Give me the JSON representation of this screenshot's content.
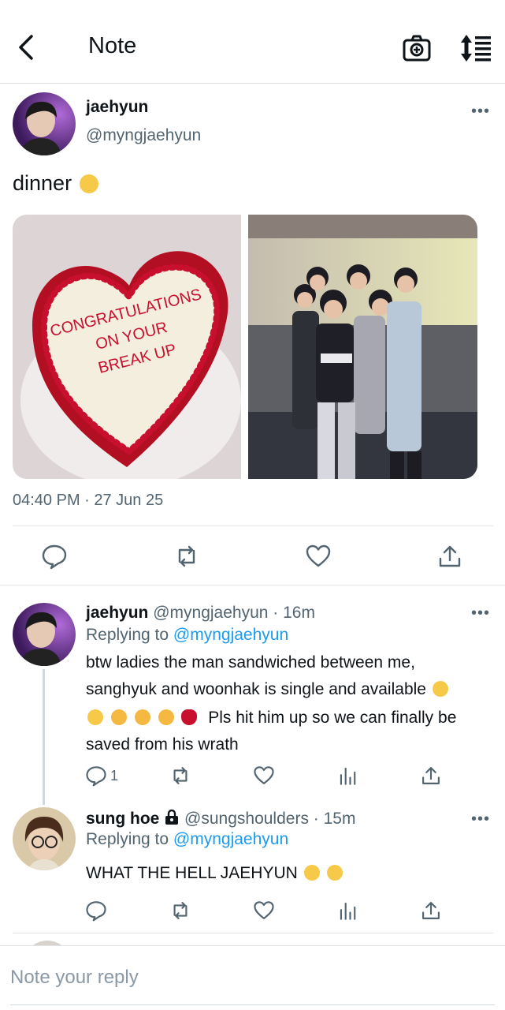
{
  "header": {
    "title": "Note"
  },
  "main_post": {
    "name": "jaehyun",
    "handle": "@myngjaehyun",
    "text": "dinner",
    "cake_text": [
      "CONGRATULATIONS",
      "ON YOUR",
      "BREAK UP"
    ],
    "timestamp": "04:40 PM · 27 Jun 25"
  },
  "replies": [
    {
      "name": "jaehyun",
      "handle": "@myngjaehyun",
      "time": "· 16m",
      "replying_prefix": "Replying to",
      "replying_to": "@myngjaehyun",
      "line1": "btw ladies the man sandwiched between me,",
      "line2": "sanghyuk and woonhak is single and available",
      "line3": "Pls hit him up so we can finally be",
      "line4": "saved from his wrath",
      "reply_count": "1"
    },
    {
      "name": "sung hoe",
      "handle": "@sungshoulders",
      "time": "· 15m",
      "replying_prefix": "Replying to",
      "replying_to": "@myngjaehyun",
      "text": "WHAT THE HELL JAEHYUN"
    }
  ],
  "composer": {
    "placeholder": "Note your reply"
  },
  "colors": {
    "link": "#1d9bf0",
    "secondary_text": "#536471",
    "cake_red": "#c8102e"
  }
}
